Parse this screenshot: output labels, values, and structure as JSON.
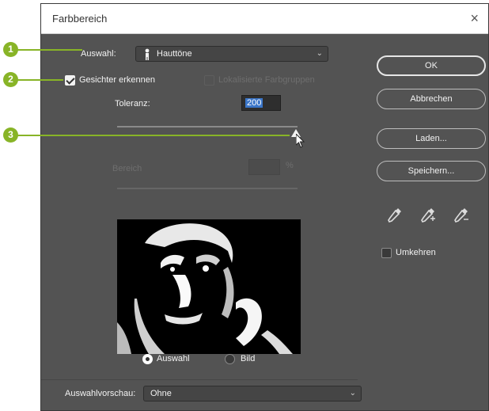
{
  "window": {
    "title": "Farbbereich",
    "close_glyph": "×"
  },
  "auswahl": {
    "label": "Auswahl:",
    "value": "Hauttöne",
    "icon": "person-icon"
  },
  "faces": {
    "label": "Gesichter erkennen",
    "checked": true
  },
  "localized": {
    "label": "Lokalisierte Farbgruppen",
    "checked": false,
    "disabled": true
  },
  "toleranz": {
    "label": "Toleranz:",
    "value": "200"
  },
  "bereich": {
    "label": "Bereich"
  },
  "buttons": {
    "ok": "OK",
    "cancel": "Abbrechen",
    "load": "Laden...",
    "save": "Speichern..."
  },
  "invert": {
    "label": "Umkehren",
    "checked": false
  },
  "preview_mode": {
    "selection_label": "Auswahl",
    "image_label": "Bild",
    "selected": "Auswahl"
  },
  "preview_select": {
    "label": "Auswahlvorschau:",
    "value": "Ohne"
  },
  "callouts": [
    "1",
    "2",
    "3"
  ],
  "colors": {
    "dialog_bg": "#535353",
    "callout": "#88b427",
    "highlight": "#3b76c9"
  }
}
